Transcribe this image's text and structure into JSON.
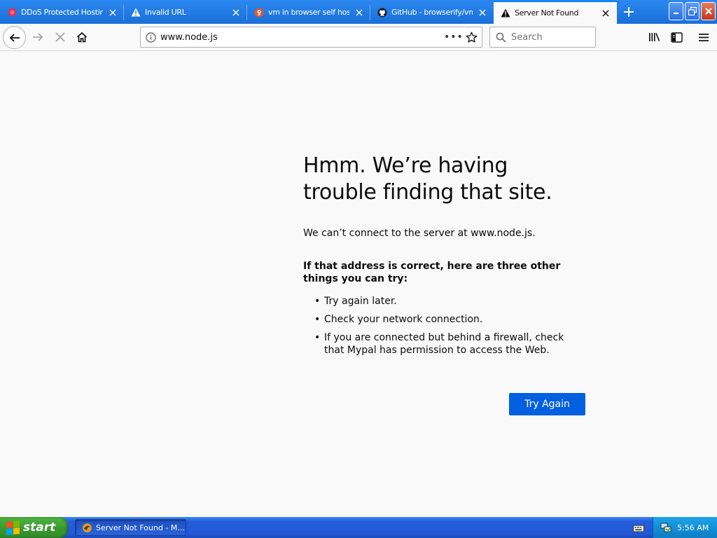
{
  "browser": {
    "tabs": [
      {
        "title": "DDoS Protected Hosting",
        "icon": "ddos-favicon-icon",
        "active": false
      },
      {
        "title": "Invalid URL",
        "icon": "warning-icon",
        "active": false
      },
      {
        "title": "vm in browser self host",
        "icon": "duckduckgo-icon",
        "active": false
      },
      {
        "title": "GitHub - browserify/vm-",
        "icon": "github-icon",
        "active": false
      },
      {
        "title": "Server Not Found",
        "icon": "warning-icon",
        "active": true
      }
    ],
    "url": "www.node.js",
    "page_actions_label": "•••",
    "search_placeholder": "Search"
  },
  "error_page": {
    "title": "Hmm. We’re having trouble finding that site.",
    "description": "We can’t connect to the server at www.node.js.",
    "suggestions_heading": "If that address is correct, here are three other things you can try:",
    "suggestions": [
      "Try again later.",
      "Check your network connection.",
      "If you are connected but behind a firewall, check that Mypal has permission to access the Web."
    ],
    "try_again_label": "Try Again"
  },
  "taskbar": {
    "start_label": "start",
    "task_label": "Server Not Found - M...",
    "clock": "5:56 AM"
  },
  "colors": {
    "tab_strip": "#1a6fd8",
    "primary_button": "#0060df",
    "page_background": "#f9f9fa"
  }
}
